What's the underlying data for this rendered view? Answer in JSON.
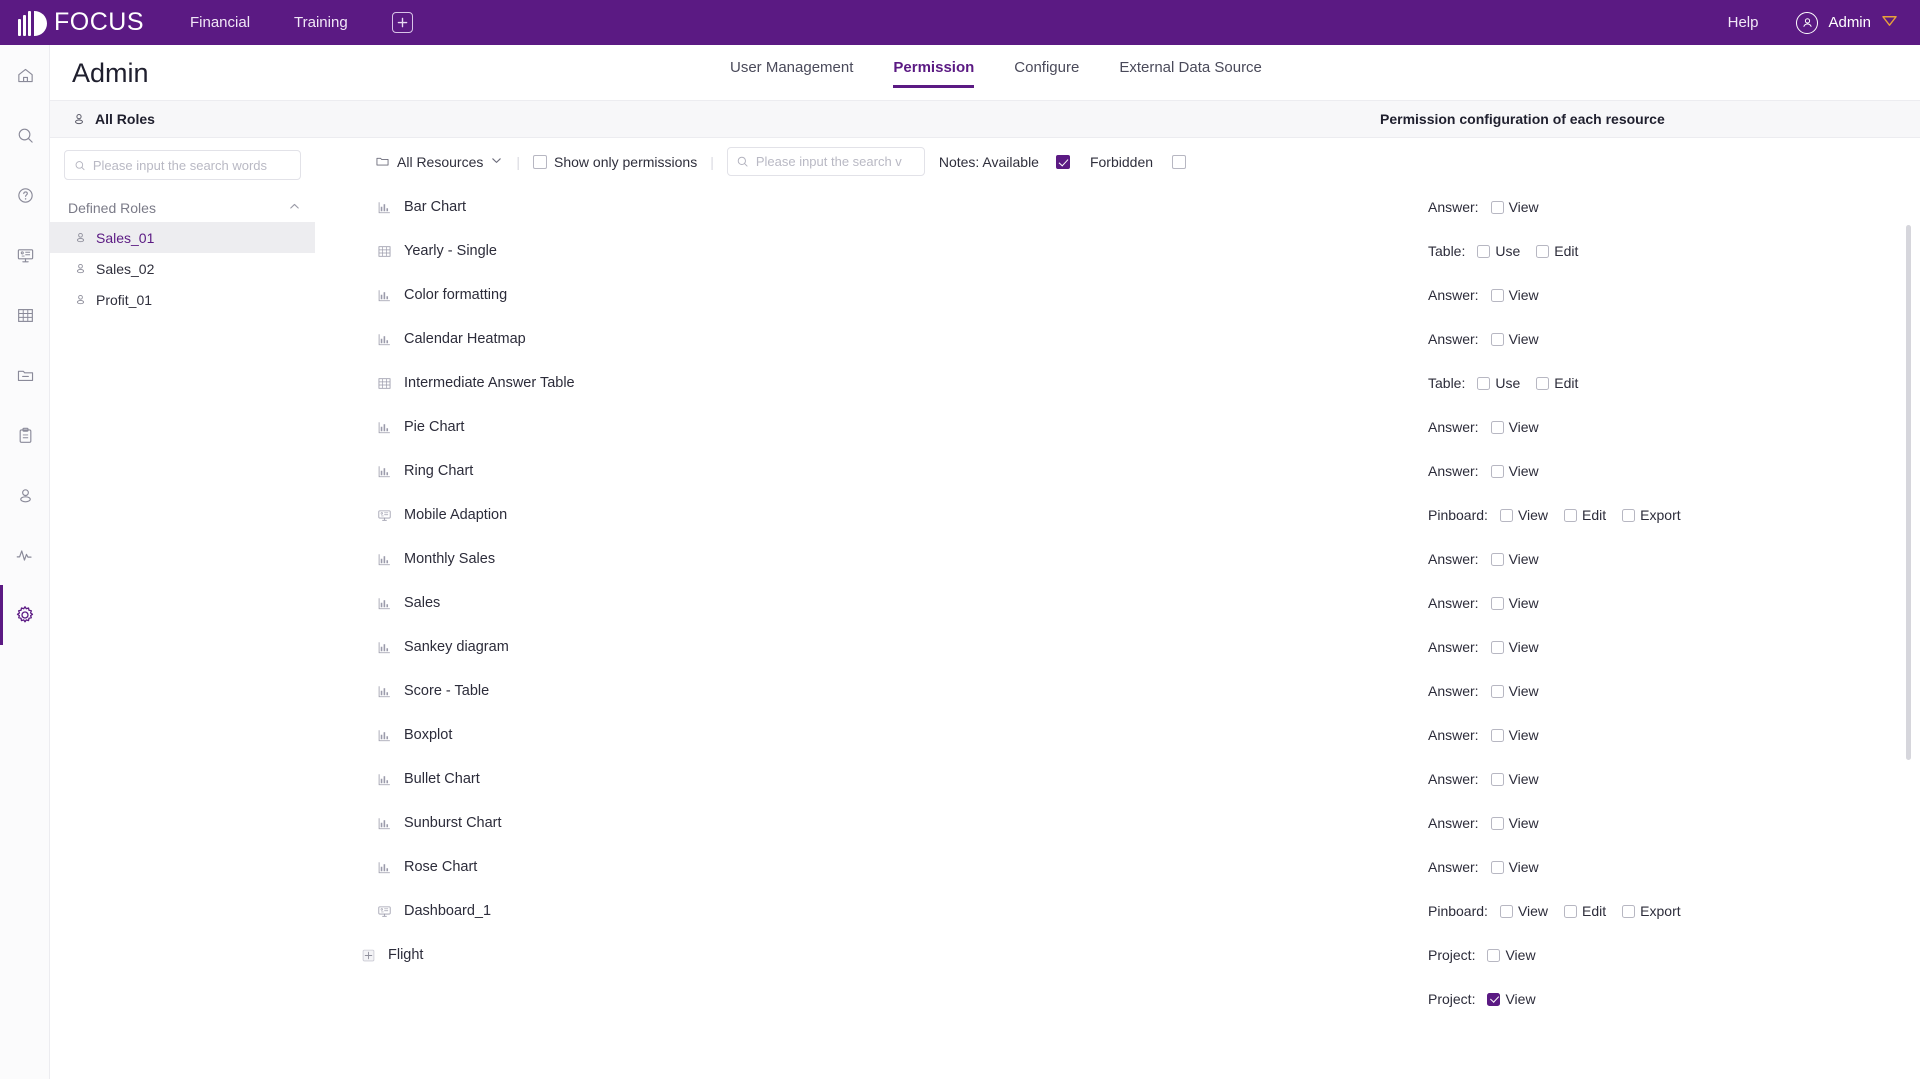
{
  "topbar": {
    "brand": "FOCUS",
    "nav": [
      {
        "label": "Financial"
      },
      {
        "label": "Training"
      }
    ],
    "add_label": "+",
    "help": "Help",
    "user": "Admin"
  },
  "rail": {
    "items": [
      {
        "name": "home-icon"
      },
      {
        "name": "search-icon"
      },
      {
        "name": "help-circle-icon"
      },
      {
        "name": "presentation-icon"
      },
      {
        "name": "table-grid-icon"
      },
      {
        "name": "folder-icon"
      },
      {
        "name": "clipboard-icon"
      },
      {
        "name": "user-icon"
      },
      {
        "name": "activity-icon"
      },
      {
        "name": "gear-icon"
      }
    ],
    "active_index": 9
  },
  "page": {
    "title": "Admin",
    "tabs": [
      {
        "label": "User Management",
        "active": false
      },
      {
        "label": "Permission",
        "active": true
      },
      {
        "label": "Configure",
        "active": false
      },
      {
        "label": "External Data Source",
        "active": false
      }
    ]
  },
  "roles_panel": {
    "header": "All Roles",
    "search_placeholder": "Please input the search words",
    "search_value": "",
    "group_label": "Defined Roles",
    "items": [
      {
        "label": "Sales_01",
        "selected": true
      },
      {
        "label": "Sales_02",
        "selected": false
      },
      {
        "label": "Profit_01",
        "selected": false
      }
    ]
  },
  "permission_panel": {
    "header": "Permission configuration of each resource",
    "filter": {
      "resource_select": "All Resources",
      "show_only_permissions": {
        "label": "Show only permissions",
        "checked": false
      },
      "search_placeholder": "Please input the search v",
      "search_value": "",
      "notes_label": "Notes: Available",
      "available_checked": true,
      "forbidden_label": "Forbidden",
      "forbidden_checked": false
    },
    "rows": [
      {
        "icon": "bar-chart-icon",
        "name": "Bar Chart",
        "indent": false,
        "perm_label": "Answer:",
        "options": [
          {
            "label": "View",
            "checked": false
          }
        ]
      },
      {
        "icon": "table-grid-icon",
        "name": "Yearly - Single",
        "indent": false,
        "perm_label": "Table:",
        "options": [
          {
            "label": "Use",
            "checked": false
          },
          {
            "label": "Edit",
            "checked": false
          }
        ]
      },
      {
        "icon": "bar-chart-icon",
        "name": "Color formatting",
        "indent": false,
        "perm_label": "Answer:",
        "options": [
          {
            "label": "View",
            "checked": false
          }
        ]
      },
      {
        "icon": "bar-chart-icon",
        "name": "Calendar Heatmap",
        "indent": false,
        "perm_label": "Answer:",
        "options": [
          {
            "label": "View",
            "checked": false
          }
        ]
      },
      {
        "icon": "table-grid-icon",
        "name": "Intermediate Answer Table",
        "indent": false,
        "perm_label": "Table:",
        "options": [
          {
            "label": "Use",
            "checked": false
          },
          {
            "label": "Edit",
            "checked": false
          }
        ]
      },
      {
        "icon": "bar-chart-icon",
        "name": "Pie Chart",
        "indent": false,
        "perm_label": "Answer:",
        "options": [
          {
            "label": "View",
            "checked": false
          }
        ]
      },
      {
        "icon": "bar-chart-icon",
        "name": "Ring Chart",
        "indent": false,
        "perm_label": "Answer:",
        "options": [
          {
            "label": "View",
            "checked": false
          }
        ]
      },
      {
        "icon": "presentation-icon",
        "name": "Mobile Adaption",
        "indent": false,
        "perm_label": "Pinboard:",
        "options": [
          {
            "label": "View",
            "checked": false
          },
          {
            "label": "Edit",
            "checked": false
          },
          {
            "label": "Export",
            "checked": false
          }
        ]
      },
      {
        "icon": "bar-chart-icon",
        "name": "Monthly Sales",
        "indent": false,
        "perm_label": "Answer:",
        "options": [
          {
            "label": "View",
            "checked": false
          }
        ]
      },
      {
        "icon": "bar-chart-icon",
        "name": "Sales",
        "indent": false,
        "perm_label": "Answer:",
        "options": [
          {
            "label": "View",
            "checked": false
          }
        ]
      },
      {
        "icon": "bar-chart-icon",
        "name": "Sankey diagram",
        "indent": false,
        "perm_label": "Answer:",
        "options": [
          {
            "label": "View",
            "checked": false
          }
        ]
      },
      {
        "icon": "bar-chart-icon",
        "name": "Score - Table",
        "indent": false,
        "perm_label": "Answer:",
        "options": [
          {
            "label": "View",
            "checked": false
          }
        ]
      },
      {
        "icon": "bar-chart-icon",
        "name": "Boxplot",
        "indent": false,
        "perm_label": "Answer:",
        "options": [
          {
            "label": "View",
            "checked": false
          }
        ]
      },
      {
        "icon": "bar-chart-icon",
        "name": "Bullet Chart",
        "indent": false,
        "perm_label": "Answer:",
        "options": [
          {
            "label": "View",
            "checked": false
          }
        ]
      },
      {
        "icon": "bar-chart-icon",
        "name": "Sunburst Chart",
        "indent": false,
        "perm_label": "Answer:",
        "options": [
          {
            "label": "View",
            "checked": false
          }
        ]
      },
      {
        "icon": "bar-chart-icon",
        "name": "Rose Chart",
        "indent": false,
        "perm_label": "Answer:",
        "options": [
          {
            "label": "View",
            "checked": false
          }
        ]
      },
      {
        "icon": "presentation-icon",
        "name": "Dashboard_1",
        "indent": false,
        "perm_label": "Pinboard:",
        "options": [
          {
            "label": "View",
            "checked": false
          },
          {
            "label": "Edit",
            "checked": false
          },
          {
            "label": "Export",
            "checked": false
          }
        ]
      },
      {
        "icon": "expand-plus-icon",
        "name": "Flight",
        "indent": true,
        "perm_label": "Project:",
        "options": [
          {
            "label": "View",
            "checked": false
          }
        ]
      },
      {
        "icon": "",
        "name": "",
        "indent": true,
        "perm_label": "Project:",
        "options": [
          {
            "label": "View",
            "checked": true
          }
        ]
      }
    ]
  },
  "colors": {
    "brand_purple": "#5b1a83",
    "accent_gold": "#e8a13a",
    "row_selected_bg": "#ededf0",
    "panel_header_bg": "#f7f7f9"
  }
}
